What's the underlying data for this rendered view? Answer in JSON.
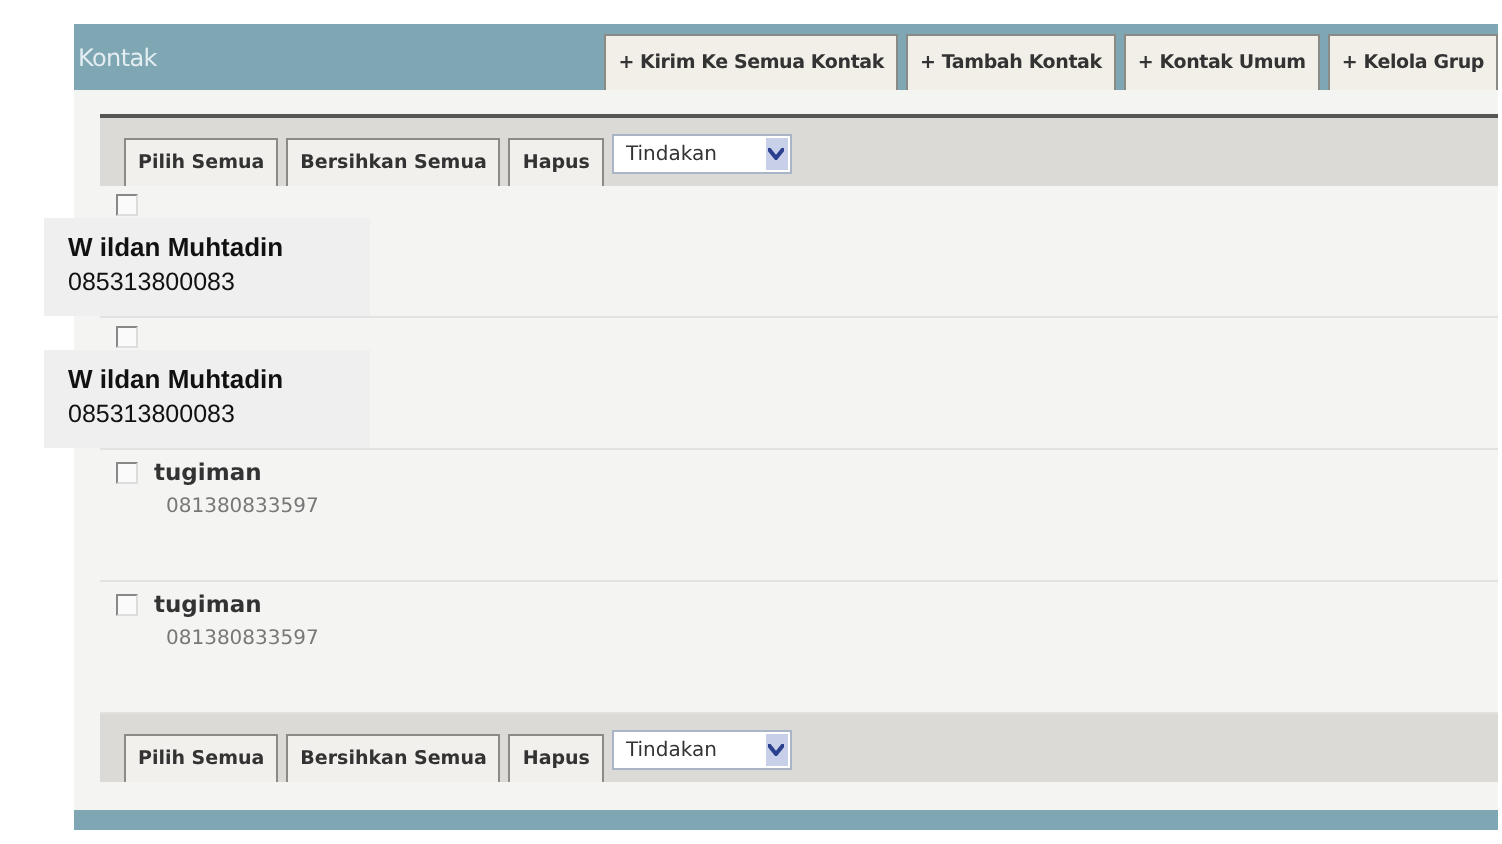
{
  "panel": {
    "title": "Kontak"
  },
  "tabs": [
    {
      "label": "+ Kirim Ke Semua Kontak"
    },
    {
      "label": "+ Tambah Kontak"
    },
    {
      "label": "+ Kontak Umum"
    },
    {
      "label": "+ Kelola Grup"
    }
  ],
  "toolbar_top": {
    "buttons": [
      "Pilih Semua",
      "Bersihkan Semua",
      "Hapus"
    ],
    "action_select": "Tindakan"
  },
  "contacts": [
    {
      "checked": false,
      "callout": {
        "name": "W ildan Muhtadin",
        "phone": "085313800083"
      }
    },
    {
      "checked": false,
      "callout": {
        "name": "W ildan Muhtadin",
        "phone": "085313800083"
      }
    },
    {
      "checked": false,
      "name": "tugiman",
      "phone": "081380833597"
    },
    {
      "checked": false,
      "name": "tugiman",
      "phone": "081380833597"
    }
  ],
  "toolbar_bottom": {
    "buttons": [
      "Pilih Semua",
      "Bersihkan Semua",
      "Hapus"
    ],
    "action_select": "Tindakan"
  }
}
